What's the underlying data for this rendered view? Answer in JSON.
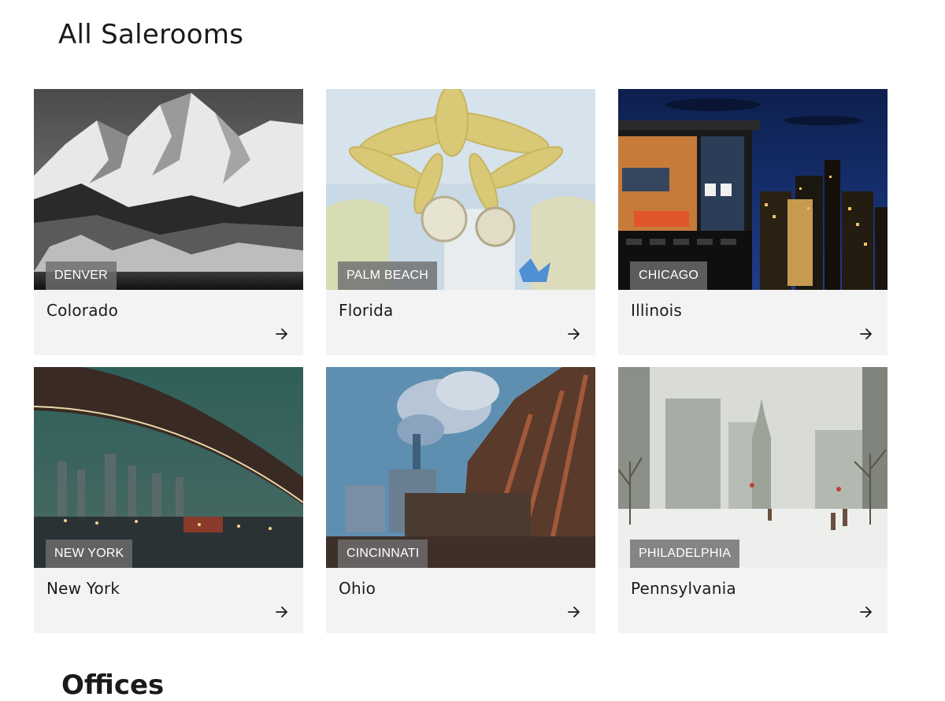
{
  "page": {
    "title": "All Salerooms",
    "next_section_title": "Offices"
  },
  "cards": [
    {
      "city": "DENVER",
      "state": "Colorado",
      "image": "mountain-landscape-bw",
      "arrow_icon": "arrow-right-icon"
    },
    {
      "city": "PALM BEACH",
      "state": "Florida",
      "image": "palm-tree-painting",
      "arrow_icon": "arrow-right-icon"
    },
    {
      "city": "CHICAGO",
      "state": "Illinois",
      "image": "night-skyline-interior",
      "arrow_icon": "arrow-right-icon"
    },
    {
      "city": "NEW YORK",
      "state": "New York",
      "image": "bridge-night-painting",
      "arrow_icon": "arrow-right-icon"
    },
    {
      "city": "CINCINNATI",
      "state": "Ohio",
      "image": "industrial-bridge-painting",
      "arrow_icon": "arrow-right-icon"
    },
    {
      "city": "PHILADELPHIA",
      "state": "Pennsylvania",
      "image": "winter-street-watercolor",
      "arrow_icon": "arrow-right-icon"
    }
  ],
  "colors": {
    "card_background": "#f3f3f3",
    "badge_background": "#6e6e6e",
    "text": "#1b1b1b"
  }
}
